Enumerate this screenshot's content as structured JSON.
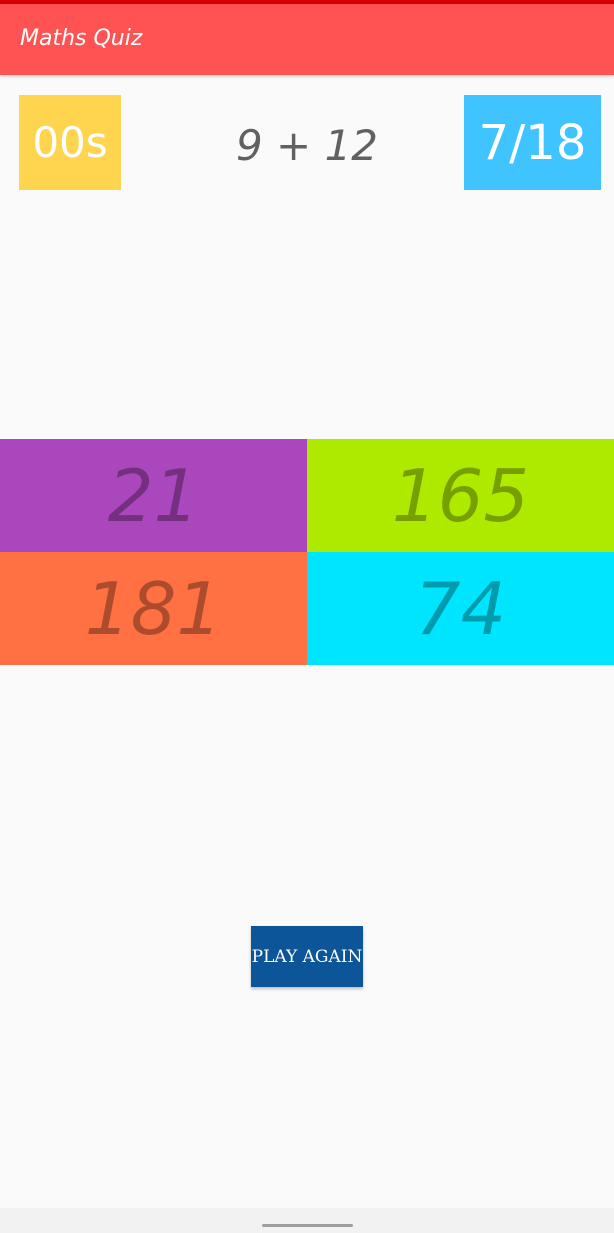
{
  "app_bar": {
    "title": "Maths Quiz",
    "color": "#ff5252"
  },
  "timer": {
    "text": "00s",
    "color": "#ffd54f"
  },
  "question": {
    "text": "9 + 12"
  },
  "score": {
    "text": "7/18",
    "color": "#40c4ff"
  },
  "answers": [
    {
      "text": "21",
      "color": "#ab47bc"
    },
    {
      "text": "165",
      "color": "#aeea00"
    },
    {
      "text": "181",
      "color": "#ff7043"
    },
    {
      "text": "74",
      "color": "#00e5ff"
    }
  ],
  "play_again": {
    "label": "PLAY AGAIN",
    "color": "#0d5599"
  }
}
